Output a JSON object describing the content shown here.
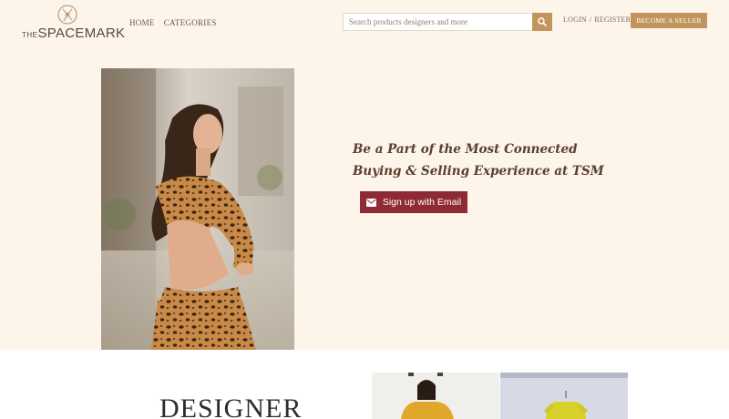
{
  "brand": {
    "the": "THE",
    "name": "SPACEMARK"
  },
  "nav": {
    "home": "HOME",
    "categories": "CATEGORIES"
  },
  "search": {
    "placeholder": "Search products designers and more"
  },
  "auth": {
    "login": "LOGIN",
    "separator": "/",
    "register": "REGISTER"
  },
  "seller_button": "BECOME A SELLER",
  "hero": {
    "title_line1": "Be a Part of the Most Connected",
    "title_line2": "Buying & Selling Experience at TSM",
    "signup_label": "Sign up with Email"
  },
  "designer": {
    "heading": "DESIGNER"
  },
  "colors": {
    "cream": "#fdf4ea",
    "accent": "#c2955d",
    "signup": "#8e2a34",
    "title": "#5a3e2e"
  },
  "icons": {
    "logo": "spacemark-logo-icon",
    "search": "search-icon",
    "signup": "envelope-icon"
  }
}
